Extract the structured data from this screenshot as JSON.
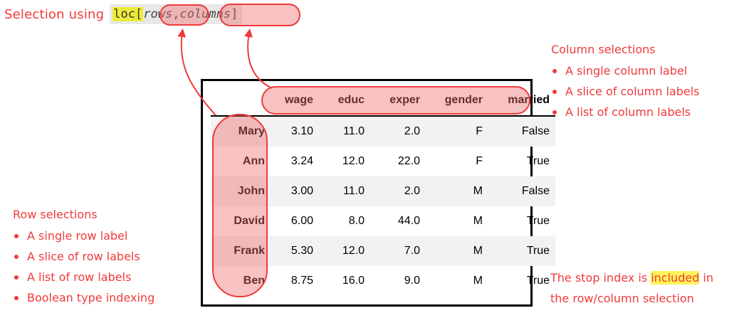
{
  "title": {
    "prefix": "Selection using",
    "code_fn": "loc[",
    "code_rows": "rows",
    "code_sep": ", ",
    "code_cols": "columns",
    "code_end": "]"
  },
  "column_notes": {
    "title": "Column selections",
    "items": [
      "A single column label",
      "A slice of column labels",
      "A list of column labels"
    ]
  },
  "row_notes": {
    "title": "Row selections",
    "items": [
      "A single row label",
      "A slice of row labels",
      "A list of row labels",
      "Boolean type indexing"
    ]
  },
  "stop_note": {
    "part1": "The stop index is ",
    "highlight": "included",
    "part2": " in",
    "line2": "the row/column selection"
  },
  "table": {
    "columns": [
      "wage",
      "educ",
      "exper",
      "gender",
      "married"
    ],
    "rows": [
      {
        "label": "Mary",
        "cells": [
          "3.10",
          "11.0",
          "2.0",
          "F",
          "False"
        ]
      },
      {
        "label": "Ann",
        "cells": [
          "3.24",
          "12.0",
          "22.0",
          "F",
          "True"
        ]
      },
      {
        "label": "John",
        "cells": [
          "3.00",
          "11.0",
          "2.0",
          "M",
          "False"
        ]
      },
      {
        "label": "David",
        "cells": [
          "6.00",
          "8.0",
          "44.0",
          "M",
          "True"
        ]
      },
      {
        "label": "Frank",
        "cells": [
          "5.30",
          "12.0",
          "7.0",
          "M",
          "True"
        ]
      },
      {
        "label": "Ben",
        "cells": [
          "8.75",
          "16.0",
          "9.0",
          "M",
          "True"
        ]
      }
    ]
  },
  "colors": {
    "annotation": "#f03a3a",
    "highlight_yellow": "#fff35a",
    "code_background": "#e8e8e8"
  }
}
